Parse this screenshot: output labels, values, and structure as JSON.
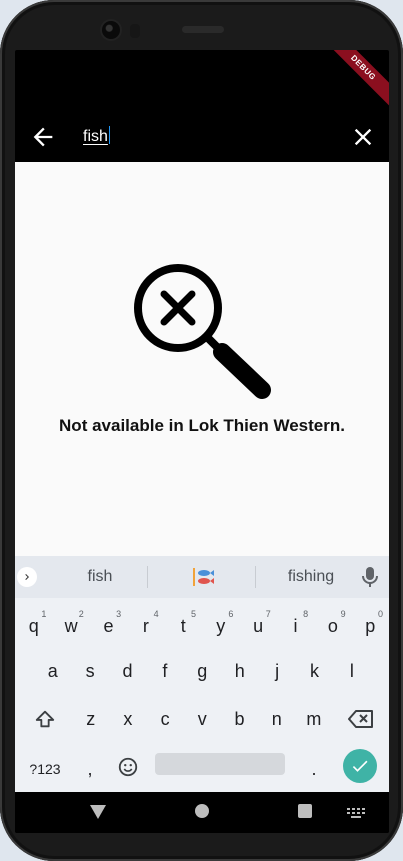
{
  "app_bar": {
    "search_value": "fish",
    "debug_banner": "DEBUG"
  },
  "empty_state": {
    "message": "Not available in Lok Thien Western."
  },
  "keyboard": {
    "suggestions": [
      "fish",
      "fishing"
    ],
    "row1": [
      {
        "key": "q",
        "hint": "1"
      },
      {
        "key": "w",
        "hint": "2"
      },
      {
        "key": "e",
        "hint": "3"
      },
      {
        "key": "r",
        "hint": "4"
      },
      {
        "key": "t",
        "hint": "5"
      },
      {
        "key": "y",
        "hint": "6"
      },
      {
        "key": "u",
        "hint": "7"
      },
      {
        "key": "i",
        "hint": "8"
      },
      {
        "key": "o",
        "hint": "9"
      },
      {
        "key": "p",
        "hint": "0"
      }
    ],
    "row2": [
      "a",
      "s",
      "d",
      "f",
      "g",
      "h",
      "j",
      "k",
      "l"
    ],
    "row3": [
      "z",
      "x",
      "c",
      "v",
      "b",
      "n",
      "m"
    ],
    "symbols_key": "?123",
    "comma_key": ",",
    "period_key": "."
  },
  "colors": {
    "app_bar_bg": "#000000",
    "content_bg": "#fafafa",
    "caret": "#2196f3",
    "enter_key": "#3fb3a6",
    "debug_ribbon": "#8b0f1f"
  },
  "icons": {
    "back": "arrow-left-icon",
    "clear": "close-icon",
    "empty_state": "search-not-found-icon",
    "suggest_expand": "chevron-right-icon",
    "mic": "mic-icon",
    "shift": "shift-icon",
    "backspace": "backspace-icon",
    "emoji": "emoji-icon",
    "enter": "check-icon"
  }
}
